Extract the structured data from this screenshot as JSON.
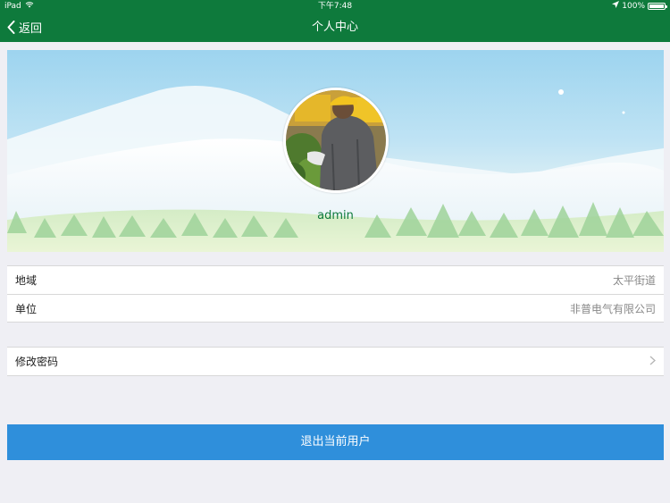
{
  "status_bar": {
    "device": "iPad",
    "time": "下午7:48",
    "battery": "100%",
    "wifi_icon": "wifi-icon",
    "location_icon": "location-arrow-icon",
    "battery_icon": "battery-icon"
  },
  "nav": {
    "back_label": "返回",
    "back_icon": "chevron-left-icon",
    "title": "个人中心"
  },
  "profile": {
    "username": "admin",
    "avatar_icon": "user-photo"
  },
  "info": [
    {
      "label": "地域",
      "value": "太平街道"
    },
    {
      "label": "单位",
      "value": "非普电气有限公司"
    }
  ],
  "settings": {
    "change_password_label": "修改密码",
    "chevron_icon": "chevron-right-icon"
  },
  "logout_label": "退出当前用户",
  "colors": {
    "brand_green": "#0e7a3c",
    "logout_blue": "#2f8fdb",
    "background": "#efeff4"
  }
}
